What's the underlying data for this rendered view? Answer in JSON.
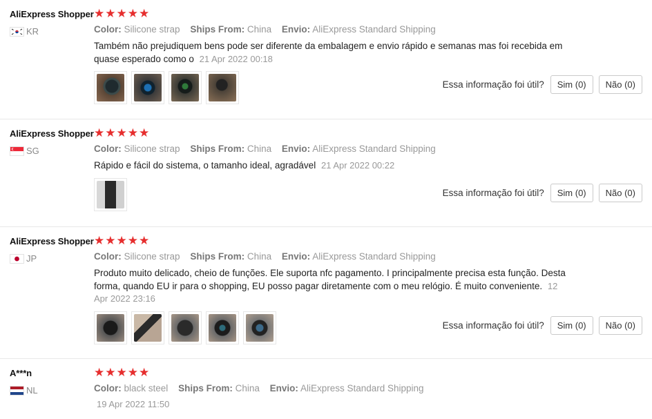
{
  "labels": {
    "color": "Color:",
    "ships_from": "Ships From:",
    "envio": "Envio:",
    "helpful_question": "Essa informação foi útil?"
  },
  "colors": {
    "star": "#e62e2e",
    "accent": "#e62e2e"
  },
  "reviews": [
    {
      "user": "AliExpress Shopper",
      "country": "KR",
      "stars": 5,
      "color": "Silicone strap",
      "ships_from": "China",
      "envio": "AliExpress Standard Shipping",
      "text": "Também não prejudiquem bens pode ser diferente da embalagem e envio rápido e semanas mas foi recebida em quase esperado como o",
      "date": "21 Apr 2022 00:18",
      "photos": [
        "photo-1",
        "photo-2",
        "photo-3",
        "photo-4"
      ],
      "yes": "Sim (0)",
      "no": "Não (0)"
    },
    {
      "user": "AliExpress Shopper",
      "country": "SG",
      "stars": 5,
      "color": "Silicone strap",
      "ships_from": "China",
      "envio": "AliExpress Standard Shipping",
      "text": "Rápido e fácil do sistema, o tamanho ideal, agradável",
      "date": "21 Apr 2022 00:22",
      "photos": [
        "photo-1"
      ],
      "yes": "Sim (0)",
      "no": "Não (0)"
    },
    {
      "user": "AliExpress Shopper",
      "country": "JP",
      "stars": 5,
      "color": "Silicone strap",
      "ships_from": "China",
      "envio": "AliExpress Standard Shipping",
      "text": "Produto muito delicado, cheio de funções. Ele suporta nfc pagamento. I principalmente precisa esta função. Desta forma, quando EU ir para o shopping, EU posso pagar diretamente com o meu relógio. É muito conveniente.",
      "date": "12 Apr 2022 23:16",
      "photos": [
        "photo-1",
        "photo-2",
        "photo-3",
        "photo-4",
        "photo-5"
      ],
      "yes": "Sim (0)",
      "no": "Não (0)"
    },
    {
      "user": "A***n",
      "country": "NL",
      "stars": 5,
      "color": "black steel",
      "ships_from": "China",
      "envio": "AliExpress Standard Shipping",
      "text": "",
      "date": "19 Apr 2022 11:50"
    }
  ]
}
